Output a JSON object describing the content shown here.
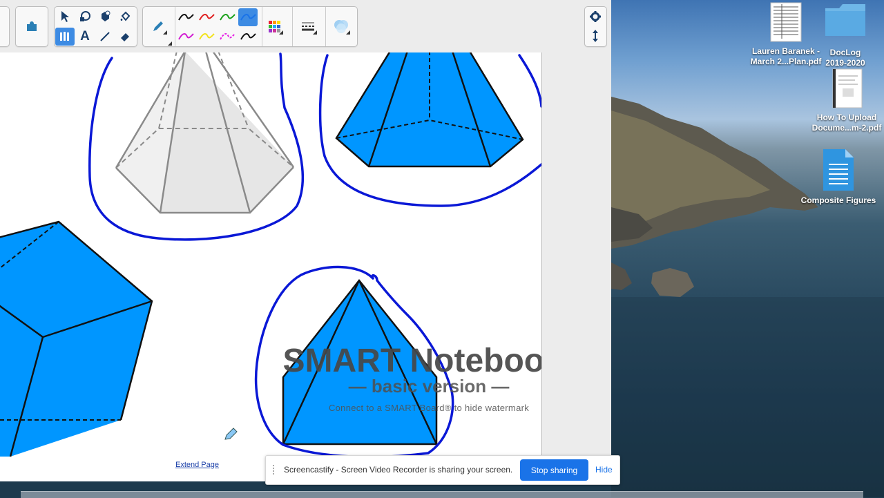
{
  "toolbar": {
    "tools": [
      "select",
      "shapes",
      "fill",
      "eraser-tool",
      "pens",
      "text",
      "line",
      "eraser"
    ],
    "pen_colors": [
      "#111111",
      "#e02020",
      "#1aa11a",
      "#1a73e8",
      "#d21dd2",
      "#f2e21a",
      "#e51ee5",
      "#111111"
    ],
    "accent": "#3d8be3"
  },
  "canvas": {
    "shape_fill": "#0096ff",
    "ink_color": "#0a18d6",
    "gray_fill": "#e6e6e6",
    "extend_link": "Extend Page"
  },
  "watermark": {
    "title": "SMART Notebook",
    "registered": "®",
    "subtitle": "— basic version —",
    "hint": "Connect to a SMART Board® to hide watermark"
  },
  "share_banner": {
    "message": "Screencastify - Screen Video Recorder is sharing your screen.",
    "stop_label": "Stop sharing",
    "hide_label": "Hide",
    "button_color": "#1a73e8"
  },
  "desktop": {
    "icons": [
      {
        "label": "Lauren Baranek -\nMarch 2...Plan.pdf",
        "kind": "pdf-icon"
      },
      {
        "label": "DocLog\n2019-2020",
        "kind": "folder-icon"
      },
      {
        "label": "How To Upload\nDocume...m-2.pdf",
        "kind": "pdf-icon"
      },
      {
        "label": "Composite Figures",
        "kind": "document-icon"
      }
    ]
  }
}
